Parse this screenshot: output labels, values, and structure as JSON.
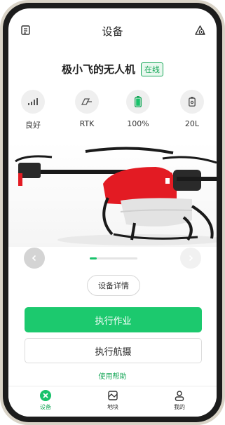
{
  "header": {
    "title": "设备"
  },
  "drone": {
    "name": "极小飞的无人机",
    "status": "在线"
  },
  "stats": [
    {
      "label": "良好",
      "icon": "signal-icon"
    },
    {
      "label": "RTK",
      "icon": "rtk-icon"
    },
    {
      "label": "100%",
      "icon": "battery-icon",
      "level": 100
    },
    {
      "label": "20L",
      "icon": "tank-icon"
    }
  ],
  "carousel": {
    "current_slide": 1
  },
  "actions": {
    "detail": "设备详情",
    "primary": "执行作业",
    "secondary": "执行航摄",
    "help": "使用帮助"
  },
  "tabs": [
    {
      "label": "设备",
      "active": true
    },
    {
      "label": "地块",
      "active": false
    },
    {
      "label": "我的",
      "active": false
    }
  ],
  "colors": {
    "accent": "#1cc96e",
    "status": "#19a85a",
    "drone_body": "#e31b23"
  }
}
